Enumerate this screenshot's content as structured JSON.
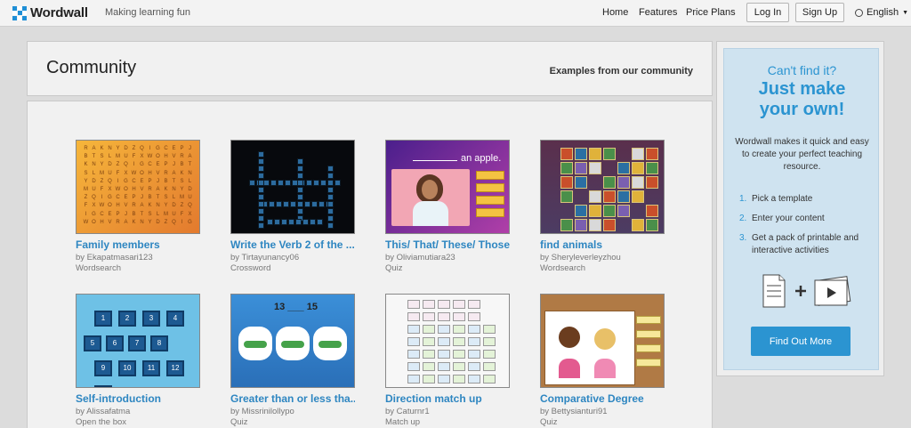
{
  "brand": {
    "name": "Wordwall",
    "tagline": "Making learning fun"
  },
  "nav": {
    "home": "Home",
    "features": "Features",
    "pricing": "Price Plans",
    "login": "Log In",
    "signup": "Sign Up",
    "language": "English"
  },
  "community": {
    "title": "Community",
    "subtitle": "Examples from our community"
  },
  "cards": [
    {
      "title": "Family members",
      "author": "by Ekapatmasari123",
      "type": "Wordsearch"
    },
    {
      "title": "Write the Verb 2 of the ...",
      "author": "by Tirtayunancy06",
      "type": "Crossword"
    },
    {
      "title": "This/ That/ These/ Those",
      "author": "by Oliviamutiara23",
      "type": "Quiz"
    },
    {
      "title": "find animals",
      "author": "by Sheryleverleyzhou",
      "type": "Wordsearch"
    },
    {
      "title": "Self-introduction",
      "author": "by Alissafatma",
      "type": "Open the box"
    },
    {
      "title": "Greater than or less tha...",
      "author": "by Missrinilollypo",
      "type": "Quiz"
    },
    {
      "title": "Direction match up",
      "author": "by Caturnr1",
      "type": "Match up"
    },
    {
      "title": "Comparative Degree",
      "author": "by Bettysianturi91",
      "type": "Quiz"
    }
  ],
  "thumb_text": {
    "quiz_sentence": "an apple.",
    "gtl_sentence": "13 ___ 15"
  },
  "sidebar": {
    "heading_small": "Can't find it?",
    "heading_big_1": "Just make",
    "heading_big_2": "your own!",
    "description": "Wordwall makes it quick and easy to create your perfect teaching resource.",
    "steps": [
      {
        "n": "1.",
        "text": "Pick a template"
      },
      {
        "n": "2.",
        "text": "Enter your content"
      },
      {
        "n": "3.",
        "text": "Get a pack of printable and interactive activities"
      }
    ],
    "cta": "Find Out More"
  },
  "colors": {
    "accent": "#2b94d1",
    "panel": "#cfe3f0",
    "background": "#dcdcdc"
  }
}
